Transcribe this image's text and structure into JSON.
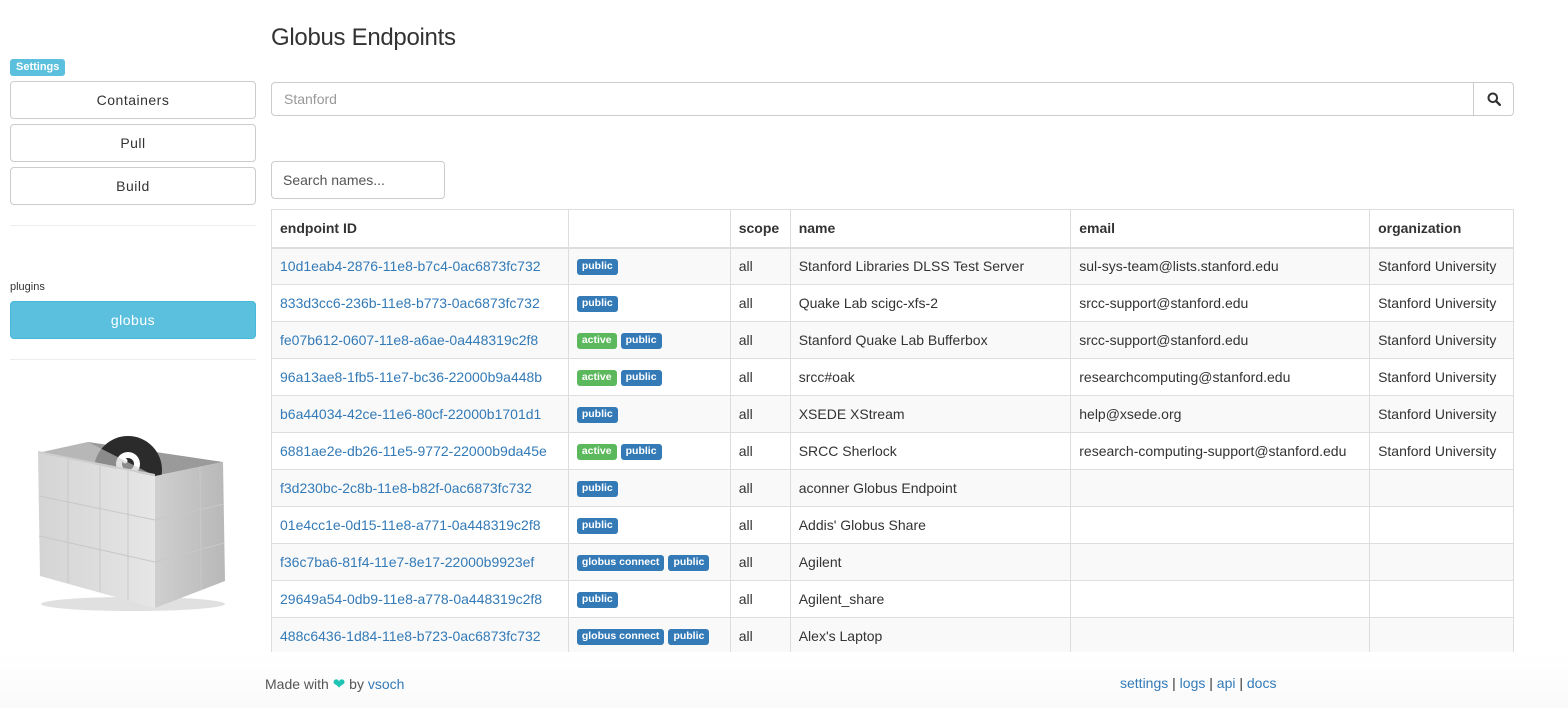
{
  "sidebar": {
    "settings_badge": "Settings",
    "buttons": [
      "Containers",
      "Pull",
      "Build"
    ],
    "plugins_label": "plugins",
    "plugin_button": "globus"
  },
  "main": {
    "title": "Globus Endpoints",
    "search": {
      "value": "",
      "placeholder": "Stanford"
    },
    "names_search": {
      "placeholder": "Search names..."
    },
    "columns": [
      "endpoint ID",
      "",
      "scope",
      "name",
      "email",
      "organization"
    ],
    "rows": [
      {
        "id": "10d1eab4-2876-11e8-b7c4-0ac6873fc732",
        "labels": [
          "public"
        ],
        "scope": "all",
        "name": "Stanford Libraries DLSS Test Server",
        "email": "sul-sys-team@lists.stanford.edu",
        "org": "Stanford University"
      },
      {
        "id": "833d3cc6-236b-11e8-b773-0ac6873fc732",
        "labels": [
          "public"
        ],
        "scope": "all",
        "name": "Quake Lab scigc-xfs-2",
        "email": "srcc-support@stanford.edu",
        "org": "Stanford University"
      },
      {
        "id": "fe07b612-0607-11e8-a6ae-0a448319c2f8",
        "labels": [
          "active",
          "public"
        ],
        "scope": "all",
        "name": "Stanford Quake Lab Bufferbox",
        "email": "srcc-support@stanford.edu",
        "org": "Stanford University"
      },
      {
        "id": "96a13ae8-1fb5-11e7-bc36-22000b9a448b",
        "labels": [
          "active",
          "public"
        ],
        "scope": "all",
        "name": "srcc#oak",
        "email": "researchcomputing@stanford.edu",
        "org": "Stanford University"
      },
      {
        "id": "b6a44034-42ce-11e6-80cf-22000b1701d1",
        "labels": [
          "public"
        ],
        "scope": "all",
        "name": "XSEDE XStream",
        "email": "help@xsede.org",
        "org": "Stanford University"
      },
      {
        "id": "6881ae2e-db26-11e5-9772-22000b9da45e",
        "labels": [
          "active",
          "public"
        ],
        "scope": "all",
        "name": "SRCC Sherlock",
        "email": "research-computing-support@stanford.edu",
        "org": "Stanford University"
      },
      {
        "id": "f3d230bc-2c8b-11e8-b82f-0ac6873fc732",
        "labels": [
          "public"
        ],
        "scope": "all",
        "name": "aconner Globus Endpoint",
        "email": "",
        "org": ""
      },
      {
        "id": "01e4cc1e-0d15-11e8-a771-0a448319c2f8",
        "labels": [
          "public"
        ],
        "scope": "all",
        "name": "Addis' Globus Share",
        "email": "",
        "org": ""
      },
      {
        "id": "f36c7ba6-81f4-11e7-8e17-22000b9923ef",
        "labels": [
          "globus connect",
          "public"
        ],
        "scope": "all",
        "name": "Agilent",
        "email": "",
        "org": ""
      },
      {
        "id": "29649a54-0db9-11e8-a778-0a448319c2f8",
        "labels": [
          "public"
        ],
        "scope": "all",
        "name": "Agilent_share",
        "email": "",
        "org": ""
      },
      {
        "id": "488c6436-1d84-11e8-b723-0ac6873fc732",
        "labels": [
          "globus connect",
          "public"
        ],
        "scope": "all",
        "name": "Alex's Laptop",
        "email": "",
        "org": ""
      }
    ]
  },
  "footer": {
    "made_with": "Made with",
    "by": "by",
    "author": "vsoch",
    "links": [
      "settings",
      "logs",
      "api",
      "docs"
    ],
    "separator": "|"
  },
  "colors": {
    "info": "#5bc0de",
    "primary": "#337ab7",
    "success": "#5cb85c",
    "heart": "#20c4b4"
  },
  "icons": [
    "search-icon",
    "heart-icon",
    "logo-box-icon"
  ]
}
